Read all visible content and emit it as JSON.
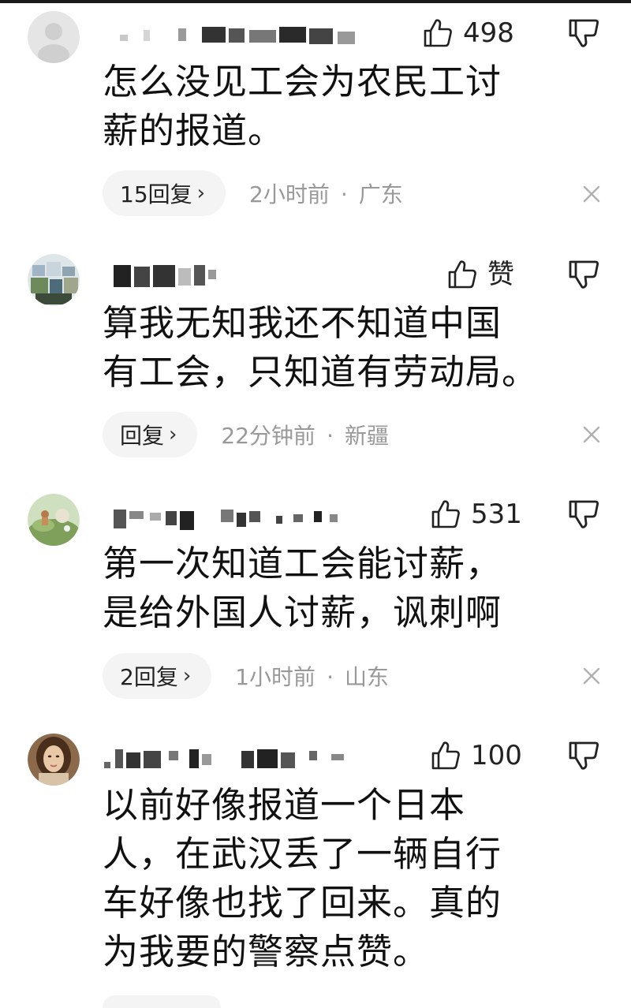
{
  "comments": [
    {
      "like_count": "498",
      "text": "怎么没见工会为农民工讨\n薪的报道。",
      "reply_label": "15回复",
      "time": "2小时前",
      "location": "广东"
    },
    {
      "like_count": "赞",
      "text": "算我无知我还不知道中国\n有工会，只知道有劳动局。",
      "reply_label": "回复",
      "time": "22分钟前",
      "location": "新疆"
    },
    {
      "like_count": "531",
      "text": "第一次知道工会能讨薪，\n是给外国人讨薪，讽刺啊",
      "reply_label": "2回复",
      "time": "1小时前",
      "location": "山东"
    },
    {
      "like_count": "100",
      "text": "以前好像报道一个日本\n人，在武汉丢了一辆自行\n车好像也找了回来。真的\n为我要的警察点赞。"
    }
  ],
  "meta_separator": "·",
  "reply_chevron": "›",
  "icons": {
    "like": "thumbs-up-outline-icon",
    "dislike": "thumbs-down-outline-icon",
    "close": "close-x-icon"
  }
}
